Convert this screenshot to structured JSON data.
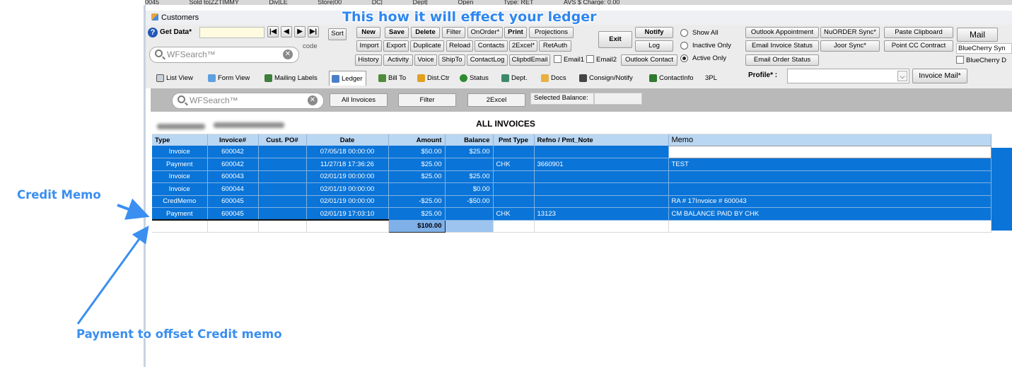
{
  "top_strip": [
    "0045",
    "Sold to|ZZTIMMY",
    "Div|LE",
    "Store|00",
    "DC|",
    "Dept|",
    "Open",
    "Type: RET",
    "AVS $ Charge: 0.00"
  ],
  "window": {
    "title": "Customers"
  },
  "toolbar": {
    "get_data": "Get Data*",
    "code_label": "code",
    "search_placeholder": "WFSearch™",
    "sort": "Sort",
    "row1": [
      "New",
      "Save",
      "Delete",
      "Filter",
      "OnOrder*",
      "Print",
      "Projections"
    ],
    "row2": [
      "Import",
      "Export",
      "Duplicate",
      "Reload",
      "Contacts",
      "2Excel*",
      "RetAuth"
    ],
    "row3": [
      "History",
      "Activity",
      "Voice",
      "ShipTo",
      "ContactLog",
      "ClipbdEmail"
    ],
    "email1": "Email1",
    "email2": "Email2",
    "outlook_contact": "Outlook Contact",
    "exit": "Exit",
    "notify": "Notify",
    "log": "Log",
    "radios": [
      "Show All",
      "Inactive Only",
      "Active Only"
    ],
    "right_buttons": [
      "Outlook Appointment",
      "NuORDER Sync*",
      "Paste Clipboard",
      "Email Invoice Status",
      "Joor Sync*",
      "Point CC Contract",
      "Email Order Status"
    ],
    "mail": "Mail",
    "bluecherry_sync": "BlueCherry Syn",
    "bluecherry_d": "BlueCherry D",
    "profile_label": "Profile* :",
    "profile_value": "",
    "invoice_mail": "Invoice Mail*"
  },
  "tabs": [
    "List View",
    "Form View",
    "Mailing Labels",
    "Ledger",
    "Bill To",
    "Dist.Ctr",
    "Status",
    "Dept.",
    "Docs",
    "Consign/Notify",
    "ContactInfo",
    "3PL"
  ],
  "ledger": {
    "search_placeholder": "WFSearch™",
    "all_invoices_button": "All Invoices",
    "filter_button": "Filter",
    "excel_button": "2Excel",
    "selected_balance_label": "Selected Balance:",
    "heading": "ALL INVOICES",
    "columns": [
      "Type",
      "Invoice#",
      "Cust. PO#",
      "Date",
      "Amount",
      "Balance",
      "Pmt Type",
      "Refno / Pmt_Note",
      "Memo"
    ],
    "rows": [
      [
        "Invoice",
        "600042",
        "",
        "07/05/18 00:00:00",
        "$50.00",
        "$25.00",
        "",
        "",
        ""
      ],
      [
        "Payment",
        "600042",
        "",
        "11/27/18 17:36:26",
        "$25.00",
        "",
        "CHK",
        "3660901",
        "TEST"
      ],
      [
        "Invoice",
        "600043",
        "",
        "02/01/19 00:00:00",
        "$25.00",
        "$25.00",
        "",
        "",
        ""
      ],
      [
        "Invoice",
        "600044",
        "",
        "02/01/19 00:00:00",
        "",
        "$0.00",
        "",
        "",
        ""
      ],
      [
        "CredMemo",
        "600045",
        "",
        "02/01/19 00:00:00",
        "-$25.00",
        "-$50.00",
        "",
        "",
        "RA # 17Invoice # 600043"
      ],
      [
        "Payment",
        "600045",
        "",
        "02/01/19 17:03:10",
        "$25.00",
        "",
        "CHK",
        "13123",
        "CM BALANCE PAID BY CHK"
      ]
    ],
    "total": "$100.00"
  },
  "annotations": {
    "title": "This how it will effect your ledger",
    "credit_memo": "Credit Memo",
    "payment_offset": "Payment to offset Credit memo"
  },
  "colors": {
    "row_blue": "#0a74d8",
    "header_blue": "#b9d6f2",
    "annotation_blue": "#3b8ff0"
  }
}
